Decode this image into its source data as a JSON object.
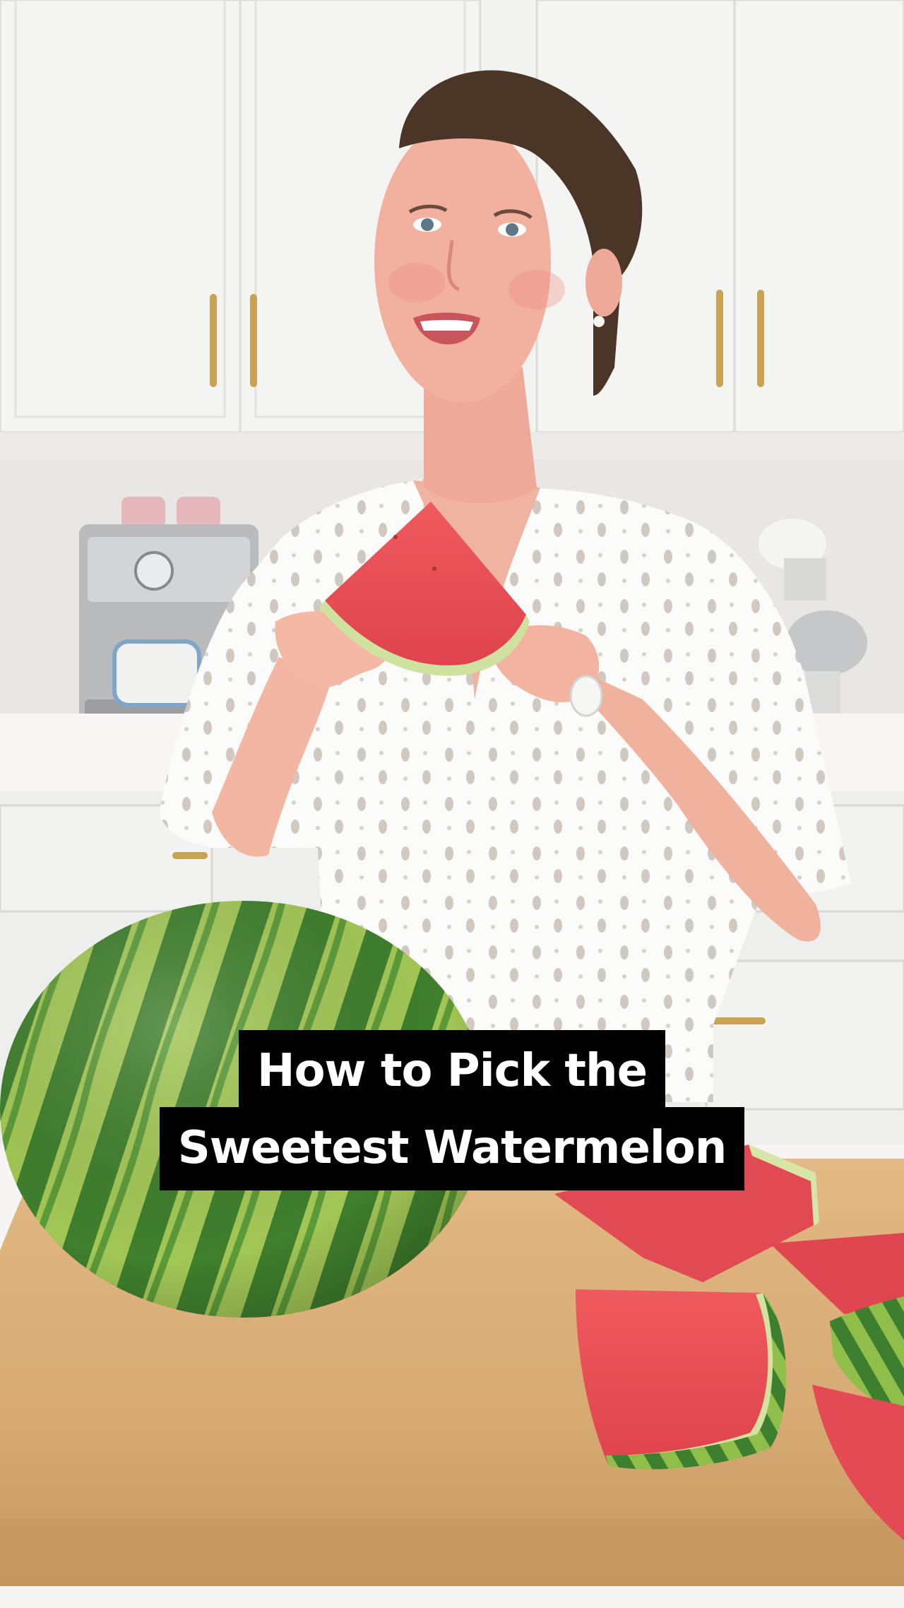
{
  "caption": {
    "line1": "How to Pick the",
    "line2": "Sweetest Watermelon"
  },
  "palette": {
    "cabinet": "#f3f3f1",
    "backsplash": "#e6e5e2",
    "counter": "#f6f5f3",
    "board": "#d9ad77",
    "melon_dark": "#3e7f2c",
    "melon_light": "#9fc54e",
    "flesh": "#e84f56",
    "rind": "#d6e4a3",
    "skin": "#f2b09f",
    "hair": "#4a3526",
    "dress": "#fbfbfa",
    "caption_bg": "#000000",
    "caption_text": "#ffffff"
  }
}
